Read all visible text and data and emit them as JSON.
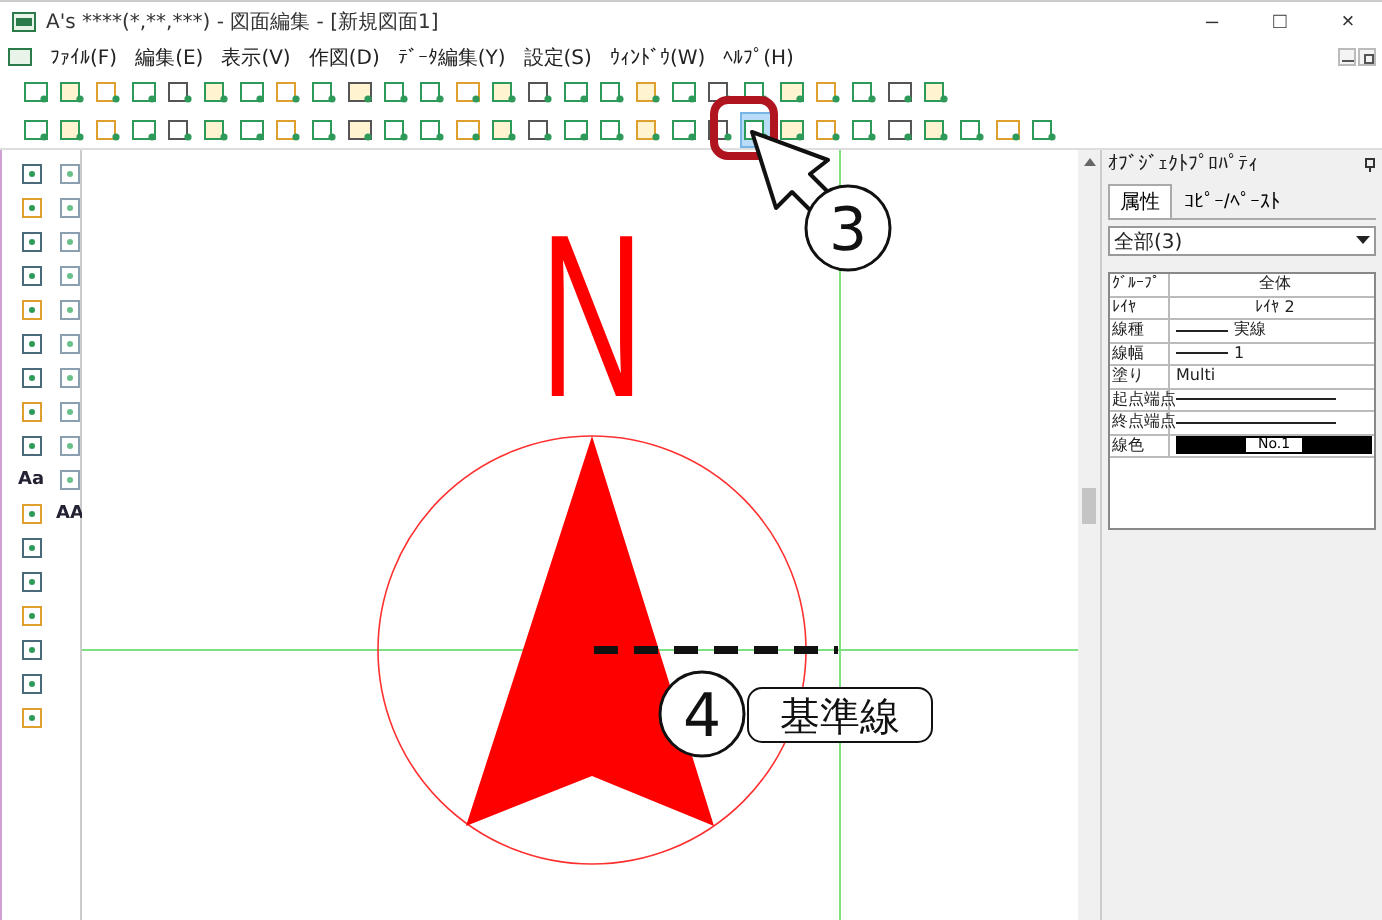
{
  "window": {
    "title": "A's ****(*,**,***) - 図面編集 - [新規図面1]",
    "controls": [
      "–",
      "□",
      "×"
    ]
  },
  "menu": [
    "ﾌｧｲﾙ(F)",
    "編集(E)",
    "表示(V)",
    "作図(D)",
    "ﾃﾞｰﾀ編集(Y)",
    "設定(S)",
    "ｳｨﾝﾄﾞｳ(W)",
    "ﾍﾙﾌﾟ(H)"
  ],
  "toolbars": [
    {
      "buttons": [
        {
          "selected": false
        },
        {
          "selected": false
        },
        {
          "selected": false
        },
        {
          "selected": false
        },
        {
          "selected": false
        },
        {
          "selected": false
        },
        {
          "selected": false
        },
        {
          "selected": false
        },
        {
          "selected": false
        },
        {
          "selected": false
        },
        {
          "selected": false
        },
        {
          "selected": false
        },
        {
          "selected": false
        },
        {
          "selected": false
        },
        {
          "selected": false
        },
        {
          "selected": false
        },
        {
          "selected": false
        },
        {
          "selected": false
        },
        {
          "selected": false
        },
        {
          "selected": false
        },
        {
          "selected": false
        },
        {
          "selected": false
        },
        {
          "selected": false
        },
        {
          "selected": false
        },
        {
          "selected": false
        },
        {
          "selected": false
        }
      ]
    },
    {
      "buttons": [
        {
          "selected": false
        },
        {
          "selected": false
        },
        {
          "selected": false
        },
        {
          "selected": false
        },
        {
          "selected": false
        },
        {
          "selected": false
        },
        {
          "selected": false
        },
        {
          "selected": false
        },
        {
          "selected": false
        },
        {
          "selected": false
        },
        {
          "selected": false
        },
        {
          "selected": false
        },
        {
          "selected": false
        },
        {
          "selected": false
        },
        {
          "selected": false
        },
        {
          "selected": false
        },
        {
          "selected": false
        },
        {
          "selected": false
        },
        {
          "selected": false
        },
        {
          "selected": false
        },
        {
          "selected": true
        },
        {
          "selected": false
        },
        {
          "selected": false
        },
        {
          "selected": false
        },
        {
          "selected": false
        },
        {
          "selected": false
        },
        {
          "selected": false
        },
        {
          "selected": false
        },
        {
          "selected": false
        }
      ]
    }
  ],
  "toolbox": {
    "left": [
      {
        "kind": "icon"
      },
      {
        "kind": "icon"
      },
      {
        "kind": "icon"
      },
      {
        "kind": "icon"
      },
      {
        "kind": "icon"
      },
      {
        "kind": "icon"
      },
      {
        "kind": "icon"
      },
      {
        "kind": "icon"
      },
      {
        "kind": "icon"
      },
      {
        "kind": "text",
        "label": "Aa"
      },
      {
        "kind": "icon"
      },
      {
        "kind": "icon"
      },
      {
        "kind": "icon"
      },
      {
        "kind": "icon"
      },
      {
        "kind": "icon"
      },
      {
        "kind": "icon"
      },
      {
        "kind": "icon"
      }
    ],
    "right": [
      {
        "kind": "icon"
      },
      {
        "kind": "icon"
      },
      {
        "kind": "icon"
      },
      {
        "kind": "icon"
      },
      {
        "kind": "icon"
      },
      {
        "kind": "icon"
      },
      {
        "kind": "icon"
      },
      {
        "kind": "icon"
      },
      {
        "kind": "icon"
      },
      {
        "kind": "icon"
      },
      {
        "kind": "text",
        "label": "AA"
      }
    ]
  },
  "canvas": {
    "north_label": "N"
  },
  "callouts": [
    {
      "number": "3"
    },
    {
      "number": "4",
      "label": "基準線"
    }
  ],
  "panel": {
    "title": "ｵﾌﾞｼﾞｪｸﾄﾌﾟﾛﾊﾟﾃｨ",
    "tabs": [
      {
        "label": "属性",
        "selected": true
      },
      {
        "label": "ｺﾋﾟｰ/ﾍﾟｰｽﾄ",
        "selected": false
      }
    ],
    "filter": "全部(3)",
    "properties": [
      {
        "name": "ｸﾞﾙｰﾌﾟ",
        "kind": "text",
        "value": "全体"
      },
      {
        "name": "ﾚｲﾔ",
        "kind": "text",
        "value": "ﾚｲﾔ 2"
      },
      {
        "name": "線種",
        "kind": "line",
        "value": "実線"
      },
      {
        "name": "線幅",
        "kind": "line",
        "value": "1"
      },
      {
        "name": "塗り",
        "kind": "plain",
        "value": "Multi"
      },
      {
        "name": "起点端点",
        "kind": "line"
      },
      {
        "name": "終点端点",
        "kind": "line"
      },
      {
        "name": "線色",
        "kind": "color",
        "value": "No.1"
      }
    ]
  }
}
